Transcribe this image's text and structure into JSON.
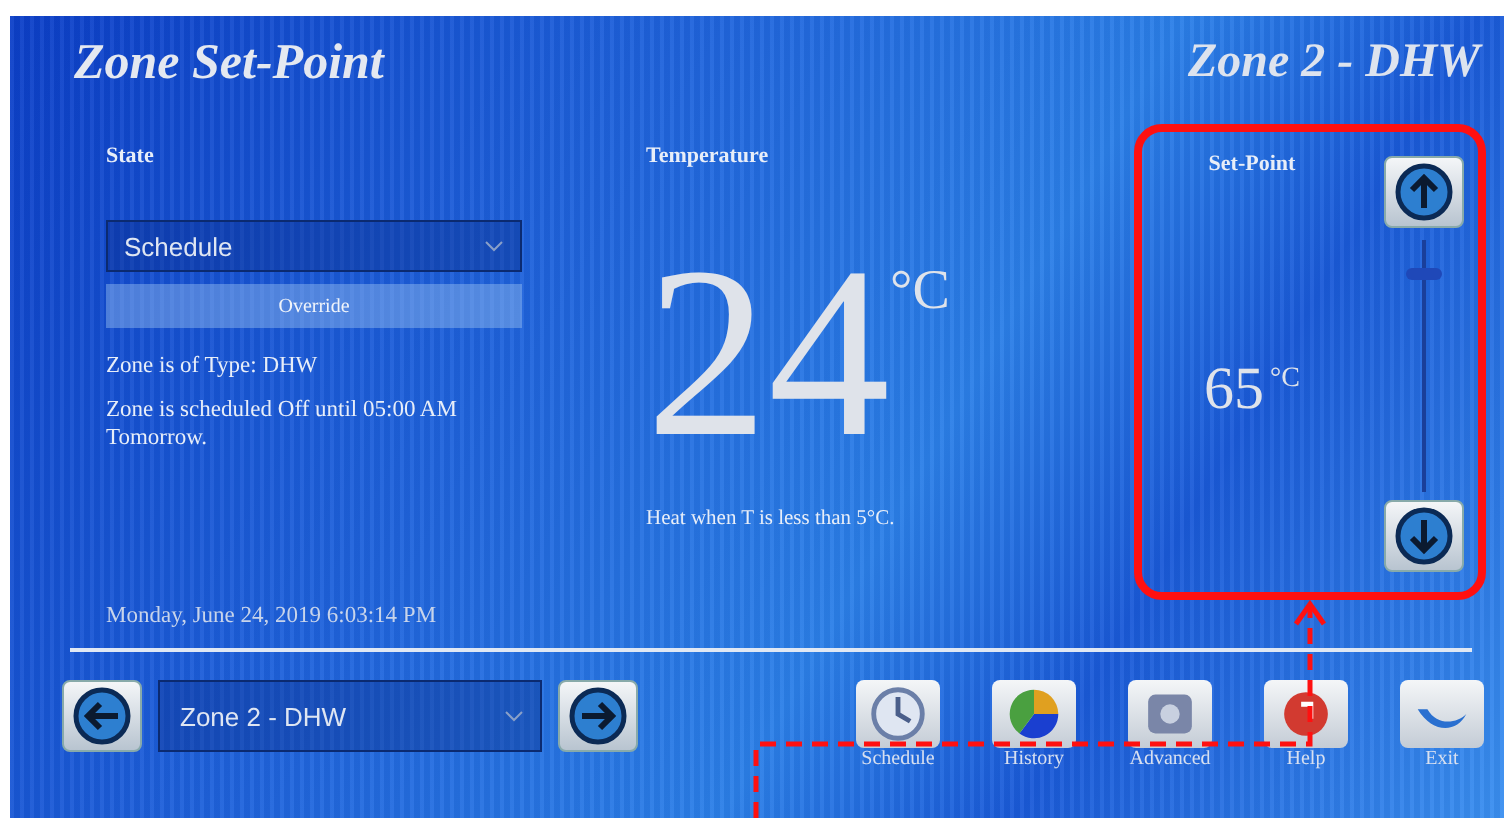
{
  "title": "Zone Set-Point",
  "zone_title": "Zone 2 - DHW",
  "state": {
    "label": "State",
    "dropdown": {
      "value": "Schedule"
    },
    "override_button": "Override",
    "info": [
      "Zone is of Type: DHW",
      "Zone is scheduled Off until 05:00 AM Tomorrow."
    ]
  },
  "datetime": "Monday, June 24, 2019 6:03:14 PM",
  "temperature": {
    "label": "Temperature",
    "value": "24",
    "unit": "°C",
    "note": "Heat when T is less than  5°C."
  },
  "setpoint": {
    "label": "Set-Point",
    "value": "65",
    "unit": "°C",
    "level": 0.88
  },
  "zone_selector": {
    "value": "Zone 2 - DHW"
  },
  "toolbar": [
    {
      "label": "Schedule",
      "kind": "schedule"
    },
    {
      "label": "History",
      "kind": "history"
    },
    {
      "label": "Advanced",
      "kind": "advanced"
    },
    {
      "label": "Help",
      "kind": "help"
    },
    {
      "label": "Exit",
      "kind": "exit"
    }
  ]
}
